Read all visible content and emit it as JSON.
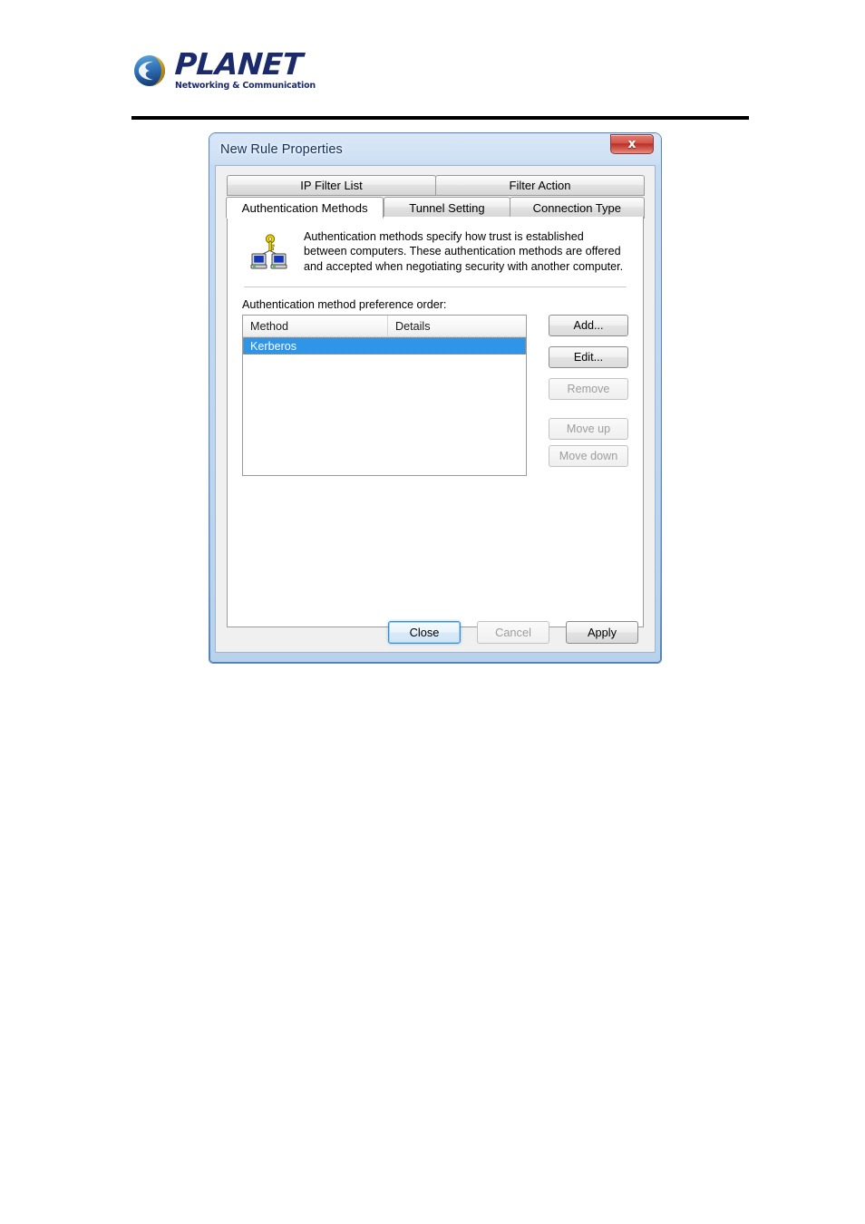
{
  "brand": {
    "name": "PLANET",
    "tagline": "Networking & Communication",
    "globe_icon": "globe-icon",
    "primary_color": "#1b2a6b",
    "accent_color": "#d9a520"
  },
  "dialog": {
    "title": "New Rule Properties",
    "close_button": {
      "label": "x",
      "icon": "close-icon",
      "color": "#bb2d24"
    },
    "tabs": {
      "row1": [
        {
          "label": "IP Filter List",
          "active": false
        },
        {
          "label": "Filter Action",
          "active": false
        }
      ],
      "row2": [
        {
          "label": "Authentication Methods",
          "active": true
        },
        {
          "label": "Tunnel Setting",
          "active": false
        },
        {
          "label": "Connection Type",
          "active": false
        }
      ]
    },
    "info": {
      "icon": "key-computers-icon",
      "text": "Authentication methods specify how trust is established between computers. These authentication methods are offered and accepted when negotiating security with another computer."
    },
    "list": {
      "label": "Authentication method preference order:",
      "columns": [
        "Method",
        "Details"
      ],
      "rows": [
        {
          "method": "Kerberos",
          "details": "",
          "selected": true
        }
      ],
      "selection_color": "#2e95e8"
    },
    "side_buttons": [
      {
        "label": "Add...",
        "enabled": true
      },
      {
        "label": "Edit...",
        "enabled": true
      },
      {
        "label": "Remove",
        "enabled": false
      },
      {
        "label": "Move up",
        "enabled": false
      },
      {
        "label": "Move down",
        "enabled": false
      }
    ],
    "bottom_buttons": [
      {
        "label": "Close",
        "enabled": true,
        "default": true
      },
      {
        "label": "Cancel",
        "enabled": false,
        "default": false
      },
      {
        "label": "Apply",
        "enabled": true,
        "default": false
      }
    ]
  }
}
